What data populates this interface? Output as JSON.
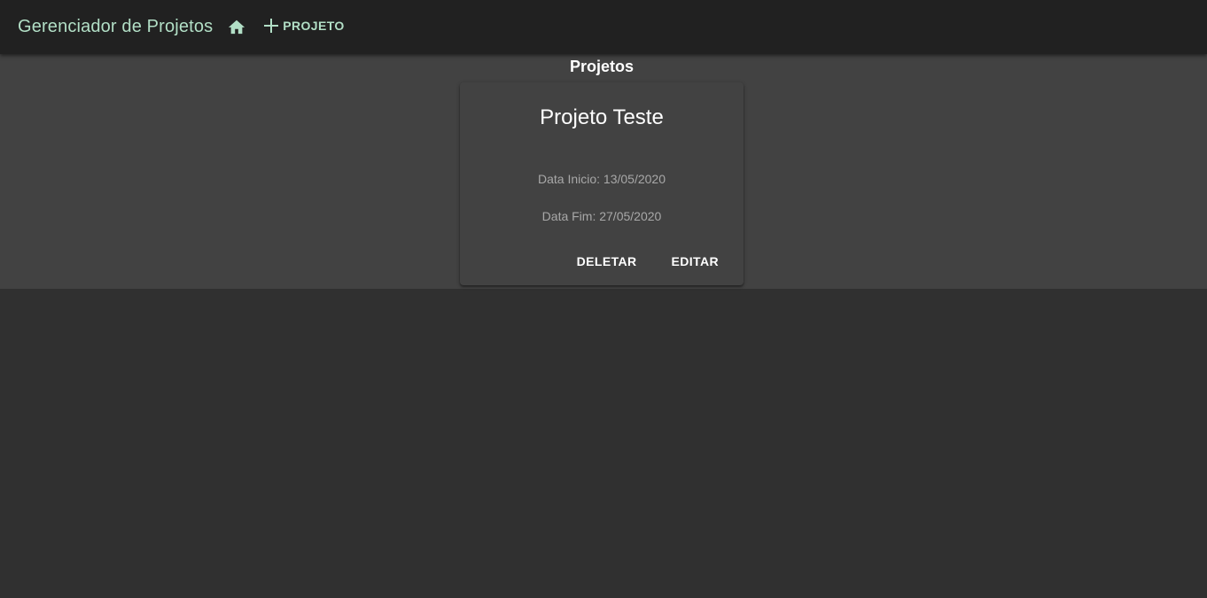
{
  "appbar": {
    "title": "Gerenciador de Projetos",
    "home_icon": "home-icon",
    "new_project_icon": "plus-icon",
    "new_project_label": "PROJETO",
    "accent_color": "#b2dfc6"
  },
  "main": {
    "section_title": "Projetos",
    "projects": [
      {
        "name": "Projeto Teste",
        "start_label": "Data Inicio: 13/05/2020",
        "end_label": "Data Fim: 27/05/2020",
        "delete_label": "DELETAR",
        "edit_label": "EDITAR"
      }
    ]
  }
}
